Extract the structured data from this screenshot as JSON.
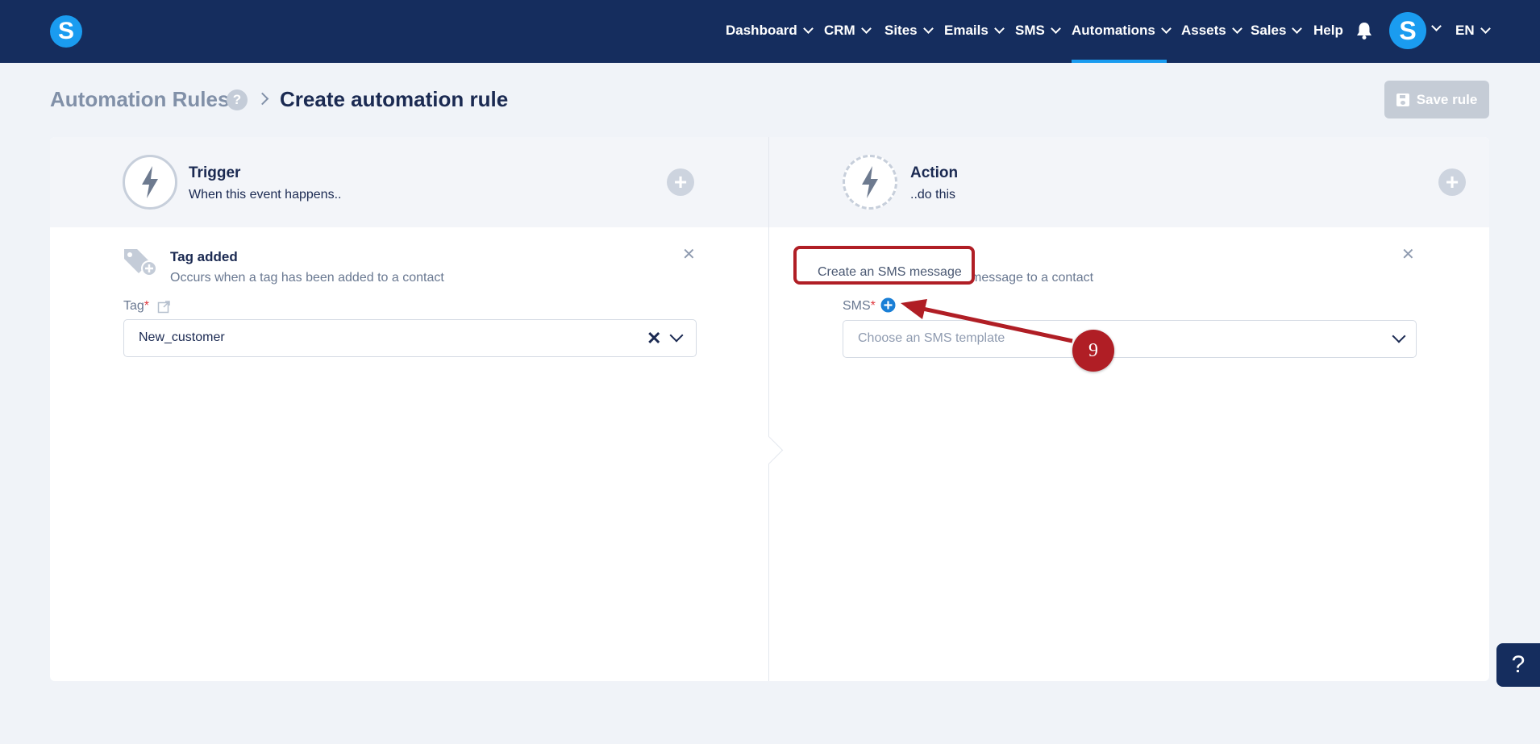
{
  "nav": {
    "items": [
      {
        "label": "Dashboard"
      },
      {
        "label": "CRM"
      },
      {
        "label": "Sites"
      },
      {
        "label": "Emails"
      },
      {
        "label": "SMS"
      },
      {
        "label": "Automations"
      },
      {
        "label": "Assets"
      },
      {
        "label": "Sales"
      },
      {
        "label": "Help"
      }
    ],
    "active": "Automations",
    "logo_letter": "S",
    "avatar_letter": "S",
    "language": "EN"
  },
  "header": {
    "breadcrumb_root": "Automation Rules",
    "help_glyph": "?",
    "title": "Create automation rule",
    "save_label": "Save rule"
  },
  "trigger": {
    "title": "Trigger",
    "subtitle": "When this event happens..",
    "item_title": "Tag added",
    "item_desc": "Occurs when a tag has been added to a contact",
    "field_label": "Tag",
    "required_mark": "*",
    "value": "New_customer"
  },
  "action": {
    "title": "Action",
    "subtitle": "..do this",
    "item_desc_partial": "message to a contact",
    "field_label": "SMS",
    "required_mark": "*",
    "placeholder": "Choose an SMS template"
  },
  "annotation": {
    "tooltip_text": "Create an SMS message",
    "step_number": "9",
    "color": "#b01e25"
  },
  "colors": {
    "nav_bg": "#152d5e",
    "accent": "#1a9cf0",
    "page_bg": "#f0f3f8"
  },
  "help_fab": "?"
}
